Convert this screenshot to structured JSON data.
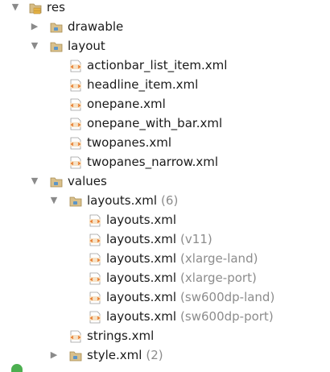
{
  "tree": {
    "res": {
      "label": "res",
      "icon": "resource-folder-icon"
    },
    "drawable": {
      "label": "drawable",
      "icon": "folder-icon"
    },
    "layout": {
      "label": "layout",
      "icon": "folder-icon"
    },
    "layout_files": [
      {
        "label": "actionbar_list_item.xml",
        "icon": "xml-file-icon"
      },
      {
        "label": "headline_item.xml",
        "icon": "xml-file-icon"
      },
      {
        "label": "onepane.xml",
        "icon": "xml-file-icon"
      },
      {
        "label": "onepane_with_bar.xml",
        "icon": "xml-file-icon"
      },
      {
        "label": "twopanes.xml",
        "icon": "xml-file-icon"
      },
      {
        "label": "twopanes_narrow.xml",
        "icon": "xml-file-icon"
      }
    ],
    "values": {
      "label": "values",
      "icon": "folder-icon"
    },
    "layouts_group": {
      "label": "layouts.xml",
      "count": "(6)",
      "icon": "folder-icon"
    },
    "layouts_variants": [
      {
        "label": "layouts.xml",
        "qualifier": ""
      },
      {
        "label": "layouts.xml",
        "qualifier": "(v11)"
      },
      {
        "label": "layouts.xml",
        "qualifier": "(xlarge-land)"
      },
      {
        "label": "layouts.xml",
        "qualifier": "(xlarge-port)"
      },
      {
        "label": "layouts.xml",
        "qualifier": "(sw600dp-land)"
      },
      {
        "label": "layouts.xml",
        "qualifier": "(sw600dp-port)"
      }
    ],
    "strings": {
      "label": "strings.xml",
      "icon": "xml-file-icon"
    },
    "style": {
      "label": "style.xml",
      "count": "(2)",
      "icon": "folder-icon"
    }
  },
  "colors": {
    "xml_icon_accent": "#e8792a",
    "folder_icon": "#c9a96b",
    "folder_badge": "#4a8fc4",
    "secondary_text": "#8c8c8c"
  }
}
